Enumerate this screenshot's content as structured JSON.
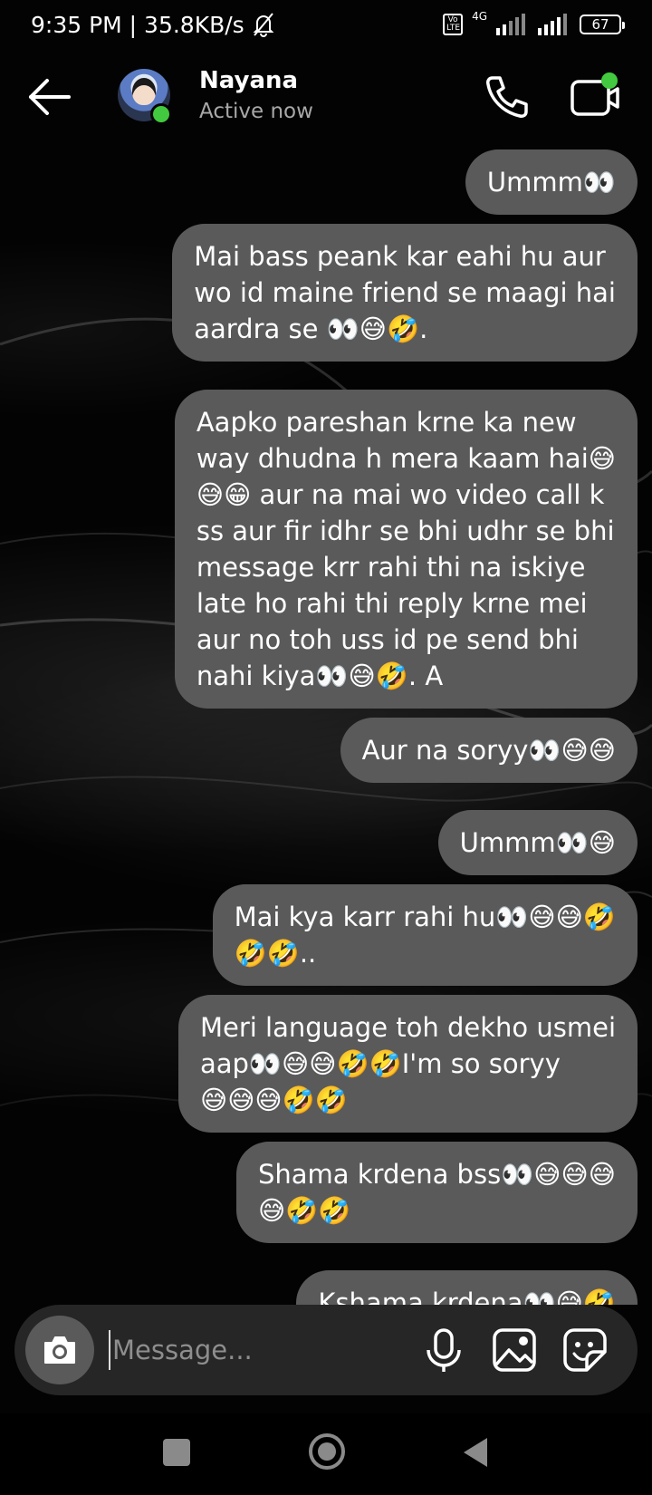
{
  "status_bar": {
    "time_speed": "9:35 PM | 35.8KB/s",
    "network_label": "4G",
    "volte_label": "Vo LTE",
    "battery": "67"
  },
  "header": {
    "contact_name": "Nayana",
    "contact_status": "Active now"
  },
  "messages": [
    "Ummm👀",
    "Mai bass peank kar eahi hu aur\nwo id maine friend se maagi hai\naardra se 👀😅🤣.",
    "Aapko pareshan krne ka new\nway dhudna h mera kaam hai😅\n😅😁 aur na mai wo video call k\nss aur fir idhr se bhi udhr se bhi\nmessage krr rahi thi na iskiye\nlate ho rahi thi reply krne mei\naur no toh uss id pe send bhi\nnahi kiya👀😅🤣. A",
    "Aur na soryy👀😅😅",
    "Ummm👀😅",
    "Mai kya karr rahi hu👀😅😅🤣\n🤣🤣..",
    "Meri language toh dekho usmei\naap👀😅😅🤣🤣I'm so soryy\n😅😅😅🤣🤣",
    "Shama krdena bss👀😅😅😅\n😅🤣🤣",
    "Kshama krdena👀😅🤣"
  ],
  "composer": {
    "placeholder": "Message..."
  },
  "colors": {
    "bubble": "#5a5a5a",
    "online": "#43c93f",
    "composer": "#262626"
  }
}
